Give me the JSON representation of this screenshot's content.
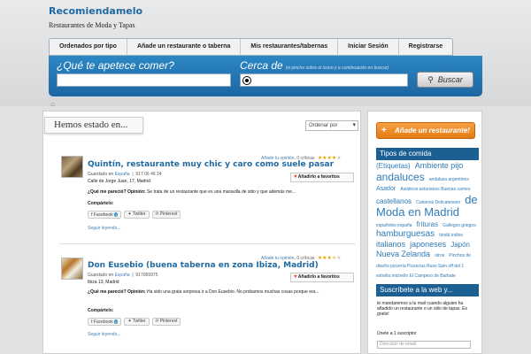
{
  "site": {
    "title": "Recomiendamelo",
    "description": "Restaurantes de Moda y Tapas"
  },
  "nav": [
    {
      "label": "Ordenados por tipo"
    },
    {
      "label": "Añade un restaurante o taberna"
    },
    {
      "label": "Mis restaurantes/tabernas"
    },
    {
      "label": "Iniciar Sesión"
    },
    {
      "label": "Registrarse"
    }
  ],
  "search": {
    "what_label": "¿Qué te apetece comer?",
    "where_label": "Cerca de",
    "where_hint": "(si pinche sobre el icono y a continuación en buscar)",
    "what_value": "",
    "where_value": "",
    "button_label": "Buscar"
  },
  "icons": {
    "home": "home-icon",
    "location": "location-icon",
    "search": "search-icon",
    "heart": "heart-icon",
    "plus": "plus-icon"
  },
  "main": {
    "section_title": "Hemos estado en...",
    "sort_label": "Ordenar por"
  },
  "posts": [
    {
      "meta_prefix": "Añade tu",
      "meta_link": "opinión",
      "meta_critics": "0 críticas",
      "rating": 4,
      "title": "Quintín, restaurante muy chic y caro como suele pasar",
      "fav_label": "Añadirlo a favoritos",
      "saved_in": "Guardado en",
      "saved_link": "España",
      "phone": "917 06 46 24",
      "address": "Calle de Jorge Juan, 17, Madrid",
      "opinion_label": "¿Qué me pareció? Opinión:",
      "opinion_text": "Se trata de un restaurante que es una maravilla de sitio y que además me...",
      "share_label": "Compártelo:",
      "share": [
        {
          "label": "Facebook",
          "count": "1"
        },
        {
          "label": "Twitter",
          "count": ""
        },
        {
          "label": "Pinterest",
          "count": ""
        }
      ],
      "more": "Seguir leyendo..."
    },
    {
      "meta_prefix": "Añade tu",
      "meta_link": "opinión",
      "meta_critics": "0 críticas",
      "rating": 3.5,
      "title": "Don Eusebio (buena taberna en zona Ibiza, Madrid)",
      "fav_label": "Añadirlo a favoritos",
      "saved_in": "Guardado en",
      "saved_link": "España",
      "phone": "917065975",
      "address": "Ibiza 13, Madrid",
      "opinion_label": "¿Qué me pareció? Opinión:",
      "opinion_text": "Ha sido una grata sorpresa ir a Don Eusebio. No probamos muchas cosas porque era...",
      "share_label": "Compártelo:",
      "share": [
        {
          "label": "Facebook",
          "count": "2"
        },
        {
          "label": "Twitter",
          "count": ""
        },
        {
          "label": "Pinterest",
          "count": ""
        }
      ],
      "more": "Seguir leyendo..."
    }
  ],
  "sidebar": {
    "add_button": "Añade un restaurante!",
    "tags_title": "Tipos de comida",
    "tags": [
      {
        "label": "(Etiquetas)",
        "size": 8
      },
      {
        "label": "Ambiente pijo",
        "size": 9
      },
      {
        "label": "andaluces",
        "size": 12
      },
      {
        "label": "andaluza argentinos",
        "size": 5
      },
      {
        "label": "Asador",
        "size": 7
      },
      {
        "label": "Asiáticos asturianos Buenas carnes",
        "size": 5
      },
      {
        "label": "castellanos",
        "size": 8
      },
      {
        "label": "Cubanos Delicatessen",
        "size": 5
      },
      {
        "label": "de Moda en Madrid",
        "size": 13
      },
      {
        "label": "españoles españa",
        "size": 5
      },
      {
        "label": "frituras",
        "size": 8
      },
      {
        "label": "Gallegos griegos",
        "size": 5
      },
      {
        "label": "hamburguesas",
        "size": 10
      },
      {
        "label": "hindú indios",
        "size": 5
      },
      {
        "label": "italianos",
        "size": 9
      },
      {
        "label": "japoneses",
        "size": 9
      },
      {
        "label": "Japón",
        "size": 8
      },
      {
        "label": "Nueva Zelanda",
        "size": 9
      },
      {
        "label": "otros",
        "size": 5
      },
      {
        "label": "Pinchos de diseño pizzería Pizzerías Ruso Spin off del 1 estrella michelín El Campero de Barbate valencianos",
        "size": 5
      },
      {
        "label": "vascos",
        "size": 7
      },
      {
        "label": "vietnamitas",
        "size": 5
      }
    ],
    "subscribe_title": "Suscríbete a la web y...",
    "subscribe_text": "te mandaremos a tu mail cuando alguien ha añadido un restaurante o un sitio de tapas. Es gratis!",
    "subscribers": "Únete a 1 suscriptor",
    "email_placeholder": "Dirección de email"
  },
  "colors": {
    "accent": "#1f6aa3",
    "link": "#2f7bb8",
    "orange": "#e47a14",
    "star": "#e6a200"
  }
}
